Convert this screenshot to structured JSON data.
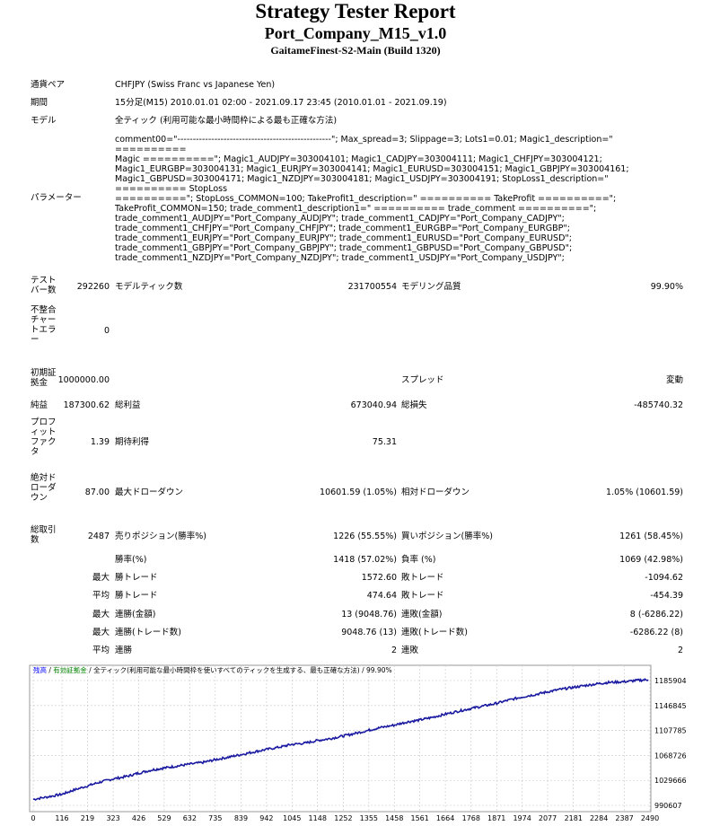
{
  "report": {
    "title": "Strategy Tester Report",
    "subtitle": "Port_Company_M15_v1.0",
    "build": "GaitameFinest-S2-Main (Build 1320)"
  },
  "info": [
    {
      "label": "通貨ペア",
      "value": "CHFJPY (Swiss Franc vs Japanese Yen)"
    },
    {
      "label": "期間",
      "value": "15分足(M15) 2010.01.01 02:00 - 2021.09.17 23:45 (2010.01.01 - 2021.09.19)"
    },
    {
      "label": "モデル",
      "value": "全ティック (利用可能な最小時間枠による最も正確な方法)"
    }
  ],
  "parameters": {
    "label": "パラメーター",
    "lines": [
      "comment00=\"--------------------------------------------------\"; Max_spread=3; Slippage=3; Lots1=0.01; Magic1_description=\" ==========",
      "Magic ==========\"; Magic1_AUDJPY=303004101; Magic1_CADJPY=303004111; Magic1_CHFJPY=303004121;",
      "Magic1_EURGBP=303004131; Magic1_EURJPY=303004141; Magic1_EURUSD=303004151; Magic1_GBPJPY=303004161;",
      "Magic1_GBPUSD=303004171; Magic1_NZDJPY=303004181; Magic1_USDJPY=303004191; StopLoss1_description=\" ========== StopLoss",
      "==========\"; StopLoss_COMMON=100; TakeProfit1_description=\" ========== TakeProfit ==========\";",
      "TakeProfit_COMMON=150; trade_comment1_description1=\" ========== trade_comment ==========\";",
      "trade_comment1_AUDJPY=\"Port_Company_AUDJPY\"; trade_comment1_CADJPY=\"Port_Company_CADJPY\";",
      "trade_comment1_CHFJPY=\"Port_Company_CHFJPY\"; trade_comment1_EURGBP=\"Port_Company_EURGBP\";",
      "trade_comment1_EURJPY=\"Port_Company_EURJPY\"; trade_comment1_EURUSD=\"Port_Company_EURUSD\";",
      "trade_comment1_GBPJPY=\"Port_Company_GBPJPY\"; trade_comment1_GBPUSD=\"Port_Company_GBPUSD\";",
      "trade_comment1_NZDJPY=\"Port_Company_NZDJPY\"; trade_comment1_USDJPY=\"Port_Company_USDJPY\";"
    ]
  },
  "stats": {
    "bars_label": "テストバー数",
    "bars": "292260",
    "ticks_label": "モデルティック数",
    "ticks": "231700554",
    "quality_label": "モデリング品質",
    "quality": "99.90%",
    "mismatch_label": "不整合チャートエラー",
    "mismatch": "0",
    "deposit_label": "初期証拠金",
    "deposit": "1000000.00",
    "spread_label": "スプレッド",
    "spread": "変動",
    "net_label": "純益",
    "net": "187300.62",
    "gross_profit_label": "総利益",
    "gross_profit": "673040.94",
    "gross_loss_label": "総損失",
    "gross_loss": "-485740.32",
    "pf_label": "プロフィットファクタ",
    "pf": "1.39",
    "expected_label": "期待利得",
    "expected": "75.31",
    "abs_dd_label": "絶対ドローダウン",
    "abs_dd": "87.00",
    "max_dd_label": "最大ドローダウン",
    "max_dd": "10601.59 (1.05%)",
    "rel_dd_label": "相対ドローダウン",
    "rel_dd": "1.05% (10601.59)",
    "trades_label": "総取引数",
    "trades": "2487",
    "short_label": "売りポジション(勝率%)",
    "short": "1226 (55.55%)",
    "long_label": "買いポジション(勝率%)",
    "long": "1261 (58.45%)",
    "win_rate_label": "勝率(%)",
    "win_rate": "1418 (57.02%)",
    "loss_rate_label": "負率 (%)",
    "loss_rate": "1069 (42.98%)",
    "max_word": "最大",
    "avg_word": "平均",
    "largest_win_label": "勝トレード",
    "largest_win": "1572.60",
    "largest_loss_label": "敗トレード",
    "largest_loss": "-1094.62",
    "avg_win_label": "勝トレード",
    "avg_win": "474.64",
    "avg_loss_label": "敗トレード",
    "avg_loss": "-454.39",
    "max_cons_wins_label": "連勝(金額)",
    "max_cons_wins": "13 (9048.76)",
    "max_cons_losses_label": "連敗(金額)",
    "max_cons_losses": "8 (-6286.22)",
    "max_cons_profit_label": "連勝(トレード数)",
    "max_cons_profit": "9048.76 (13)",
    "max_cons_loss_label": "連敗(トレード数)",
    "max_cons_loss": "-6286.22 (8)",
    "avg_cons_wins_label": "連勝",
    "avg_cons_wins": "2",
    "avg_cons_losses_label": "連敗",
    "avg_cons_losses": "2"
  },
  "chart_header": {
    "balance": "残高",
    "sep1": " / ",
    "volume": "有効証拠金",
    "sep2": " / ",
    "model": "全ティック(利用可能な最小時間枠を使いすべてのティックを生成する、最も正確な方法)",
    "sep3": " / ",
    "quality": "99.90%"
  },
  "colors": {
    "balance_line": "#1a1aa0",
    "balance_header": "#0000ff",
    "volume_header": "#008000",
    "grid": "#c8c8c8",
    "border": "#9a9a9a"
  },
  "chart_data": {
    "type": "line",
    "title": "",
    "xlabel": "",
    "ylabel": "",
    "x_ticks": [
      0,
      116,
      219,
      323,
      426,
      529,
      632,
      735,
      839,
      942,
      1045,
      1148,
      1252,
      1355,
      1458,
      1561,
      1664,
      1768,
      1871,
      1974,
      2077,
      2181,
      2284,
      2387,
      2490
    ],
    "y_ticks": [
      990607,
      1029666,
      1068726,
      1107785,
      1146845,
      1185904
    ],
    "xlim": [
      0,
      2487
    ],
    "ylim": [
      990607,
      1185904
    ],
    "series": [
      {
        "x": [
          0,
          60,
          116,
          160,
          219,
          270,
          323,
          380,
          426,
          480,
          529,
          580,
          632,
          690,
          735,
          790,
          839,
          890,
          942,
          1000,
          1045,
          1100,
          1148,
          1200,
          1252,
          1300,
          1355,
          1400,
          1458,
          1510,
          1561,
          1610,
          1664,
          1720,
          1768,
          1820,
          1871,
          1920,
          1974,
          2030,
          2077,
          2130,
          2181,
          2230,
          2284,
          2330,
          2387,
          2440,
          2487
        ],
        "y": [
          1000000,
          1004000,
          1008000,
          1014000,
          1021000,
          1027000,
          1032000,
          1036000,
          1041000,
          1046000,
          1049000,
          1052000,
          1055000,
          1058000,
          1062000,
          1066000,
          1070000,
          1074000,
          1078000,
          1082000,
          1086000,
          1088000,
          1092000,
          1095000,
          1099000,
          1103000,
          1108000,
          1112000,
          1116000,
          1121000,
          1124000,
          1128000,
          1133000,
          1138000,
          1142000,
          1146000,
          1150000,
          1155000,
          1160000,
          1164000,
          1168000,
          1172000,
          1175000,
          1178000,
          1181000,
          1183000,
          1184000,
          1186000,
          1187300
        ]
      }
    ]
  }
}
